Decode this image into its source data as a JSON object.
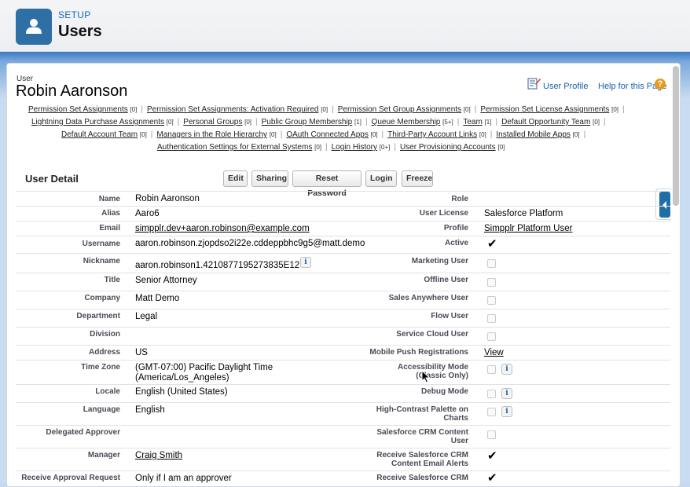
{
  "header": {
    "section": "SETUP",
    "title": "Users"
  },
  "record": {
    "type_label": "User",
    "name": "Robin Aaronson"
  },
  "help": {
    "profile_link": "User Profile",
    "help_link": "Help for this Page"
  },
  "related_links": [
    [
      {
        "label": "Permission Set Assignments",
        "count": "[0]"
      },
      {
        "label": "Permission Set Assignments: Activation Required",
        "count": "[0]"
      },
      {
        "label": "Permission Set Group Assignments",
        "count": "[0]"
      },
      {
        "label": "Permission Set License Assignments",
        "count": "[0]"
      }
    ],
    [
      {
        "label": "Lightning Data Purchase Assignments",
        "count": "[0]"
      },
      {
        "label": "Personal Groups",
        "count": "[0]"
      },
      {
        "label": "Public Group Membership",
        "count": "[1]"
      },
      {
        "label": "Queue Membership",
        "count": "[5+]"
      },
      {
        "label": "Team",
        "count": "[1]"
      },
      {
        "label": "Default Opportunity Team",
        "count": "[0]"
      }
    ],
    [
      {
        "label": "Default Account Team",
        "count": "[0]"
      },
      {
        "label": "Managers in the Role Hierarchy",
        "count": "[0]"
      },
      {
        "label": "OAuth Connected Apps",
        "count": "[0]"
      },
      {
        "label": "Third-Party Account Links",
        "count": "[0]"
      },
      {
        "label": "Installed Mobile Apps",
        "count": "[0]"
      }
    ],
    [
      {
        "label": "Authentication Settings for External Systems",
        "count": "[0]"
      },
      {
        "label": "Login History",
        "count": "[0+]"
      },
      {
        "label": "User Provisioning Accounts",
        "count": "[0]"
      }
    ]
  ],
  "detail": {
    "title": "User Detail",
    "buttons": [
      "Edit",
      "Sharing",
      "Reset Password",
      "Login",
      "Freeze"
    ],
    "left": [
      {
        "label": "Name",
        "value": "Robin Aaronson"
      },
      {
        "label": "Alias",
        "value": "Aaro6"
      },
      {
        "label": "Email",
        "value": "simpplr.dev+aaron.robinson@example.com"
      },
      {
        "label": "Username",
        "value": "aaron.robinson.zjopdso2i22e.cddeppbhc9g5@matt.demo"
      },
      {
        "label": "Nickname",
        "value": "aaron.robinson1.4210877195273835E12"
      },
      {
        "label": "Title",
        "value": "Senior Attorney"
      },
      {
        "label": "Company",
        "value": "Matt Demo"
      },
      {
        "label": "Department",
        "value": "Legal"
      },
      {
        "label": "Division",
        "value": ""
      },
      {
        "label": "Address",
        "value": "US"
      },
      {
        "label": "Time Zone",
        "value": "(GMT-07:00) Pacific Daylight Time",
        "value2": "(America/Los_Angeles)"
      },
      {
        "label": "Locale",
        "value": "English (United States)"
      },
      {
        "label": "Language",
        "value": "English"
      },
      {
        "label": "Delegated Approver",
        "value": ""
      },
      {
        "label": "Manager",
        "value": "Craig Smith"
      },
      {
        "label": "Receive Approval Request",
        "value": "Only if I am an approver"
      }
    ],
    "right": [
      {
        "label": "Role",
        "value": ""
      },
      {
        "label": "User License",
        "value": "Salesforce Platform"
      },
      {
        "label": "Profile",
        "value": "Simpplr Platform User"
      },
      {
        "label": "Active",
        "checked": true
      },
      {
        "label": "Marketing User",
        "checked": false
      },
      {
        "label": "Offline User",
        "checked": false
      },
      {
        "label": "Sales Anywhere User",
        "checked": false
      },
      {
        "label": "Flow User",
        "checked": false
      },
      {
        "label": "Service Cloud User",
        "checked": false
      },
      {
        "label": "Mobile Push Registrations",
        "value": "View"
      },
      {
        "label": "Accessibility Mode (Classic Only)",
        "checked": false
      },
      {
        "label": "Debug Mode",
        "checked": false
      },
      {
        "label": "High-Contrast Palette on Charts",
        "checked": false
      },
      {
        "label": "Salesforce CRM Content User",
        "checked": false
      },
      {
        "label": "Receive Salesforce CRM Content Email Alerts",
        "checked": true
      },
      {
        "label": "Receive Salesforce CRM",
        "checked": true
      }
    ]
  }
}
